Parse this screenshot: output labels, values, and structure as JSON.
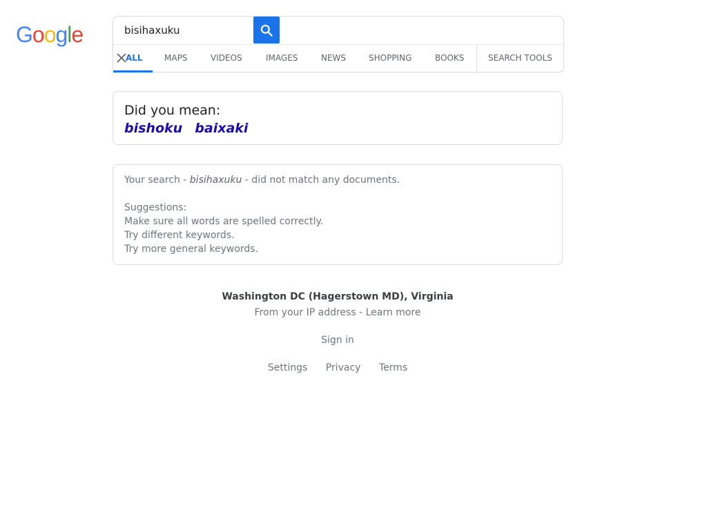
{
  "logo": {
    "letters": [
      "G",
      "o",
      "o",
      "g",
      "l",
      "e"
    ]
  },
  "search": {
    "query": "bisihaxuku"
  },
  "tabs": [
    {
      "label": "ALL",
      "active": true
    },
    {
      "label": "MAPS"
    },
    {
      "label": "VIDEOS"
    },
    {
      "label": "IMAGES"
    },
    {
      "label": "NEWS"
    },
    {
      "label": "SHOPPING"
    },
    {
      "label": "BOOKS"
    },
    {
      "label": "SEARCH TOOLS"
    }
  ],
  "did_you_mean": {
    "title": "Did you mean:",
    "suggestions": [
      "bishoku",
      "baixaki"
    ]
  },
  "no_match": {
    "prefix": "Your search - ",
    "query": "bisihaxuku",
    "suffix": " - did not match any documents.",
    "suggestions_title": "Suggestions:",
    "tips": [
      "Make sure all words are spelled correctly.",
      "Try different keywords.",
      "Try more general keywords."
    ]
  },
  "footer": {
    "location": "Washington DC (Hagerstown MD), Virginia",
    "ip_prefix": "From your IP address - ",
    "learn_more": "Learn more",
    "sign_in": "Sign in",
    "links": [
      "Settings",
      "Privacy",
      "Terms"
    ]
  },
  "colors": {
    "accent": "#1a73e8",
    "link": "#1a0dab",
    "logo_blue": "#4285f4",
    "logo_red": "#ea4335",
    "logo_yellow": "#fbbc05",
    "logo_green": "#34a853"
  },
  "icons": {
    "search_button": "search-icon",
    "clear": "close-icon"
  }
}
